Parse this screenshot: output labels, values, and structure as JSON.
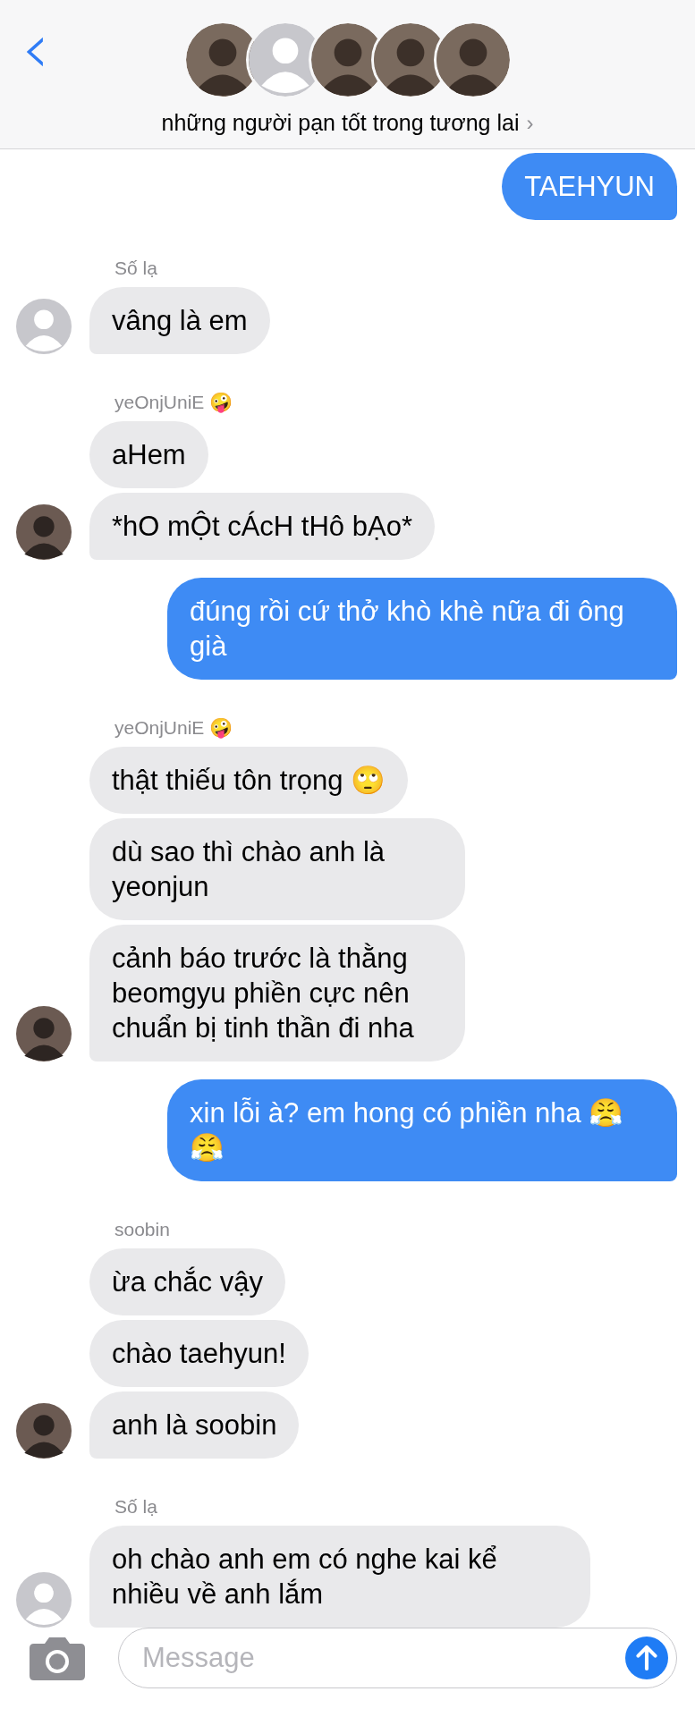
{
  "header": {
    "back": "‹",
    "members": [
      {
        "kind": "photo"
      },
      {
        "kind": "placeholder"
      },
      {
        "kind": "photo"
      },
      {
        "kind": "photo"
      },
      {
        "kind": "photo"
      }
    ],
    "title": "những người pạn tốt trong tương lai",
    "title_chevron": "›"
  },
  "thread": [
    {
      "kind": "outgoing",
      "messages": [
        "TAEHYUN"
      ]
    },
    {
      "kind": "incoming",
      "sender": "Số lạ",
      "avatar": {
        "kind": "placeholder"
      },
      "messages": [
        "vâng là em"
      ]
    },
    {
      "kind": "incoming",
      "sender": "yeOnjUniE 🤪",
      "avatar": {
        "kind": "photo"
      },
      "messages": [
        "aHem",
        "*hO mỘt cÁcH tHô bẠo*"
      ]
    },
    {
      "kind": "outgoing",
      "messages": [
        "đúng rồi cứ thở khò khè nữa đi ông già"
      ]
    },
    {
      "kind": "incoming",
      "sender": "yeOnjUniE 🤪",
      "avatar": {
        "kind": "photo"
      },
      "messages": [
        "thật thiếu tôn trọng 🙄",
        "dù sao thì chào anh là yeonjun",
        "cảnh báo trước là thằng beomgyu phiền cực nên chuẩn bị tinh thần đi nha"
      ]
    },
    {
      "kind": "outgoing",
      "messages": [
        "xin lỗi à? em hong có phiền nha 😤 😤"
      ]
    },
    {
      "kind": "incoming",
      "sender": "soobin",
      "avatar": {
        "kind": "photo"
      },
      "messages": [
        "ừa chắc vậy",
        "chào taehyun!",
        "anh là soobin"
      ]
    },
    {
      "kind": "incoming",
      "sender": "Số lạ",
      "avatar": {
        "kind": "placeholder"
      },
      "messages": [
        "oh chào anh em có nghe kai kể nhiều về anh lắm"
      ]
    }
  ],
  "composer": {
    "placeholder": "Message"
  }
}
